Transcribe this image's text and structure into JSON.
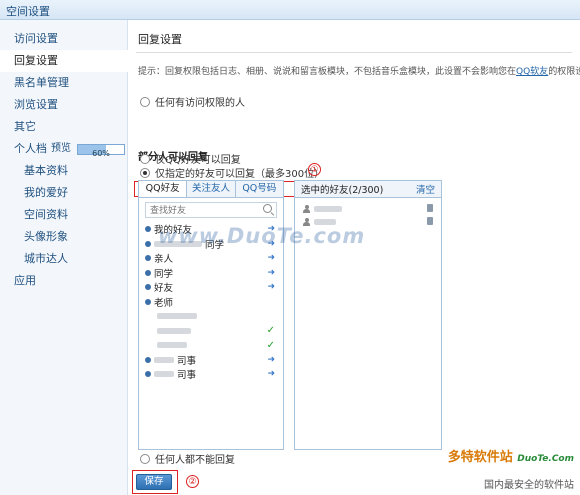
{
  "window": {
    "title": "空间设置"
  },
  "sidebar": {
    "items": [
      {
        "label": "访问设置"
      },
      {
        "label": "回复设置"
      },
      {
        "label": "黑名单管理"
      },
      {
        "label": "浏览设置"
      },
      {
        "label": "其它"
      }
    ],
    "profile": {
      "label": "个人档",
      "badge": "预览",
      "progress_text": "60%",
      "progress": 0.6
    },
    "sub_items": [
      {
        "label": "基本资料"
      },
      {
        "label": "我的爱好"
      },
      {
        "label": "空间资料"
      },
      {
        "label": "头像形象"
      },
      {
        "label": "城市达人"
      }
    ],
    "last_item": {
      "label": "应用"
    }
  },
  "main": {
    "title": "回复设置",
    "tip": "提示：回复权限包括日志、相册、说说和留言板模块，不包括音乐盒模块，此设置不会影响您在",
    "tip_link": "QQ软友",
    "tip_tail": "的权限设置。",
    "option_anyone": "任何有访问权限的人",
    "section_title": "部分人可以回复",
    "option_qq_friends": "仅QQ好友可以回复",
    "option_specified": "仅指定的好友可以回复（最多300位）",
    "marker_1": "①",
    "marker_2": "②",
    "option_none": "任何人都不能回复",
    "save_label": "保存"
  },
  "friend_panel": {
    "tabs": [
      "QQ好友",
      "关注友人",
      "QQ号码"
    ],
    "search_placeholder": "查找好友",
    "groups": [
      {
        "label": "我的好友"
      },
      {
        "label": "同学"
      },
      {
        "label": "亲人"
      },
      {
        "label": "同学"
      },
      {
        "label": "好友"
      },
      {
        "label": "老师"
      }
    ],
    "extra_rows": [
      {
        "label": "司事"
      },
      {
        "label": "司事"
      }
    ]
  },
  "selected_panel": {
    "title": "选中的好友(2/300)",
    "clear_label": "清空"
  },
  "watermark": "www.DuoTe.com",
  "brand": {
    "name": "多特软件站",
    "site": "DuoTe.Com",
    "slogan": "国内最安全的软件站"
  },
  "colors": {
    "accent": "#2465a8",
    "highlight": "#dd2222",
    "save": "#2d6fb2"
  }
}
